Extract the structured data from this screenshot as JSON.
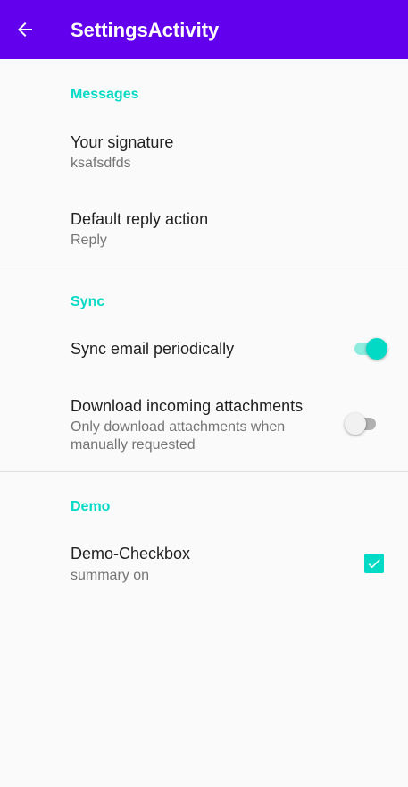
{
  "app_bar": {
    "title": "SettingsActivity",
    "back_icon": "arrow-left-icon",
    "background": "#6200ee"
  },
  "colors": {
    "accent": "#03dac5",
    "accent_track": "#8eecdf",
    "switch_off_thumb": "#f1f1f1",
    "switch_off_track": "#b0b0b0",
    "divider": "#e0e0e0"
  },
  "sections": {
    "messages": {
      "header": "Messages",
      "signature": {
        "title": "Your signature",
        "summary": "ksafsdfds"
      },
      "reply": {
        "title": "Default reply action",
        "summary": "Reply"
      }
    },
    "sync": {
      "header": "Sync",
      "sync_email": {
        "title": "Sync email periodically",
        "enabled": true
      },
      "attachments": {
        "title": "Download incoming attachments",
        "summary": "Only download attachments when manually requested",
        "enabled": false
      }
    },
    "demo": {
      "header": "Demo",
      "checkbox": {
        "title": "Demo-Checkbox",
        "summary": "summary on",
        "checked": true,
        "check_icon": "checkmark-icon"
      }
    }
  }
}
